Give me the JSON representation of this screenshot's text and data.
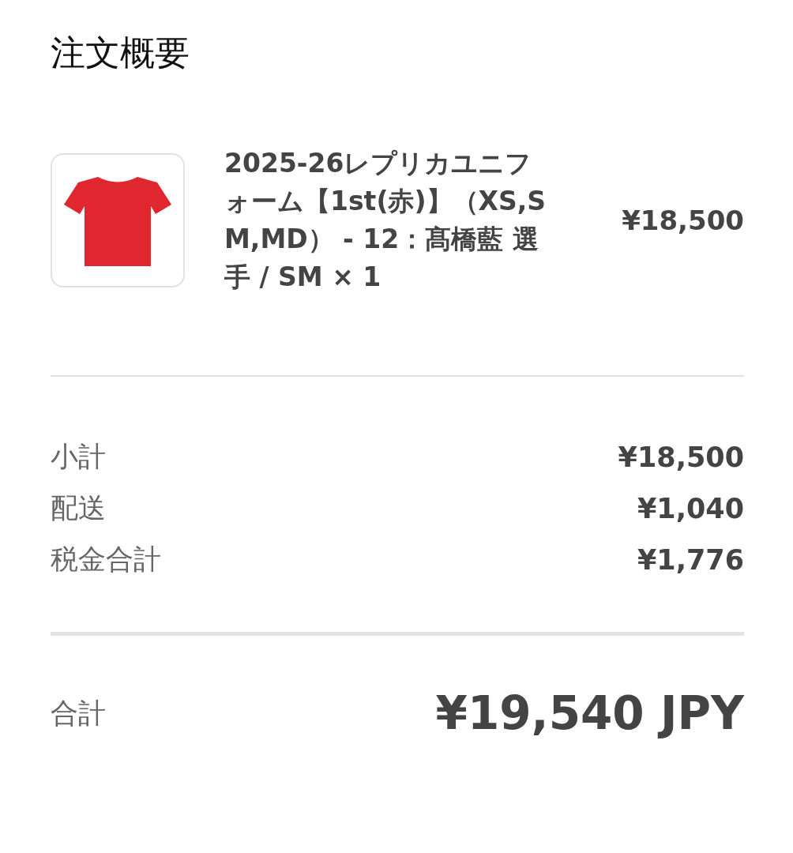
{
  "title": "注文概要",
  "item": {
    "name": "2025-26レプリカユニフォーム【1st(赤)】（XS,SM,MD） - 12：髙橋藍 選手 / SM × 1",
    "price": "¥18,500"
  },
  "summary": [
    {
      "label": "小計",
      "value": "¥18,500"
    },
    {
      "label": "配送",
      "value": "¥1,040"
    },
    {
      "label": "税金合計",
      "value": "¥1,776"
    }
  ],
  "total": {
    "label": "合計",
    "value": "¥19,540 JPY"
  }
}
